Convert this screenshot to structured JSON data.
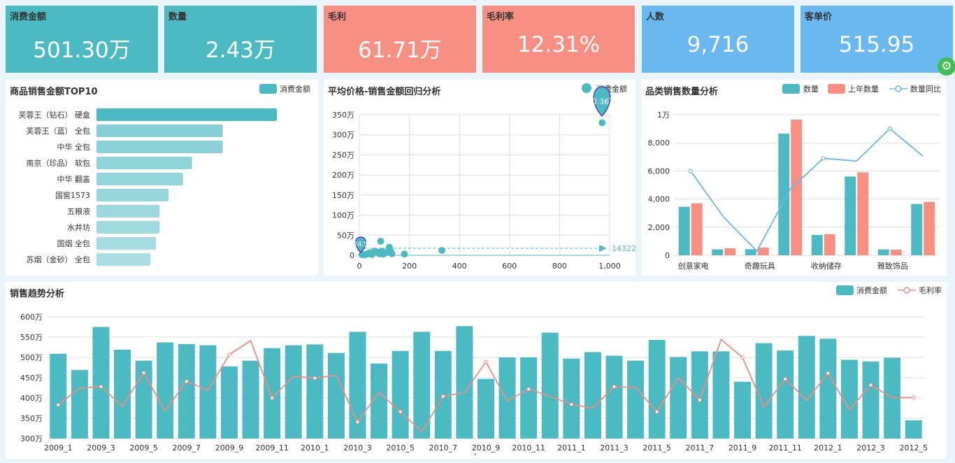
{
  "colors": {
    "teal": "#4bbac3",
    "salmon": "#f78f82",
    "blue": "#6ab8f0",
    "line_blue": "#6ab8e8",
    "line_salmon": "#f08c80"
  },
  "kpis": [
    {
      "label": "消费金额",
      "value": "501.30万",
      "color": "#4bbac3"
    },
    {
      "label": "数量",
      "value": "2.43万",
      "color": "#4bbac3"
    },
    {
      "label": "毛利",
      "value": "61.71万",
      "color": "#f78f82"
    },
    {
      "label": "毛利率",
      "value": "12.31%",
      "color": "#f78f82"
    },
    {
      "label": "人数",
      "value": "9,716",
      "color": "#6ab8f0"
    },
    {
      "label": "客单价",
      "value": "515.95",
      "color": "#6ab8f0"
    }
  ],
  "toggles": {
    "top": "˅",
    "bottom": "˄",
    "side_icon": "⚙"
  },
  "panels": {
    "top10": {
      "title": "商品销售金额TOP10",
      "legend": "消费金额"
    },
    "scatter": {
      "title": "平均价格-销售金额回归分析",
      "legend": "消费金额",
      "pin_top": "30.36万",
      "pin_left": "24.5",
      "arrow_label": "14322"
    },
    "category": {
      "title": "品类销售数量分析",
      "legend": [
        "数量",
        "上年数量",
        "数量同比"
      ]
    },
    "trend": {
      "title": "销售趋势分析",
      "legend": [
        "消费金额",
        "毛利率"
      ]
    }
  },
  "chart_data": [
    {
      "type": "bar",
      "orientation": "horizontal",
      "title": "商品销售金额TOP10",
      "categories": [
        "芙蓉王（钻石） 硬盒",
        "芙蓉王（蓝） 全包",
        "中华 全包",
        "南京（珍品） 软包",
        "中华 翻盖",
        "国窖1573",
        "五粮液",
        "水井坊",
        "国烟 全包",
        "苏烟（金砂） 全包"
      ],
      "values": [
        100,
        70,
        70,
        53,
        48,
        40,
        35,
        35,
        33,
        30
      ],
      "series": [
        {
          "name": "消费金额"
        }
      ]
    },
    {
      "type": "scatter",
      "title": "平均价格-销售金额回归分析",
      "x_ticks": [
        "0",
        "200",
        "400",
        "600",
        "800",
        "1,000"
      ],
      "y_ticks": [
        "0",
        "50万",
        "100万",
        "150万",
        "200万",
        "250万",
        "300万",
        "350万"
      ],
      "xlim": [
        0,
        1000
      ],
      "ylim": [
        0,
        350
      ],
      "series": [
        {
          "name": "消费金额",
          "points": [
            [
              5,
              24.5
            ],
            [
              10,
              2
            ],
            [
              20,
              1
            ],
            [
              30,
              3
            ],
            [
              40,
              6
            ],
            [
              50,
              2
            ],
            [
              60,
              10
            ],
            [
              70,
              8
            ],
            [
              80,
              4
            ],
            [
              85,
              35
            ],
            [
              90,
              10
            ],
            [
              95,
              3
            ],
            [
              110,
              7
            ],
            [
              120,
              20
            ],
            [
              125,
              10
            ],
            [
              130,
              4
            ],
            [
              180,
              3
            ],
            [
              330,
              12
            ],
            [
              970,
              330
            ]
          ]
        }
      ]
    },
    {
      "type": "bar",
      "title": "品类销售数量分析",
      "x_labels": [
        "创意家电",
        "",
        "奇趣玩具",
        "",
        "收纳储存",
        "",
        "雅致饰品",
        ""
      ],
      "y_ticks": [
        "0",
        "2,000",
        "4,000",
        "6,000",
        "8,000",
        "1万"
      ],
      "ylim": [
        0,
        10000
      ],
      "series": [
        {
          "name": "数量",
          "type": "bar",
          "values": [
            3450,
            420,
            430,
            8650,
            1450,
            5600,
            420,
            3650
          ]
        },
        {
          "name": "上年数量",
          "type": "bar",
          "values": [
            3700,
            500,
            550,
            9650,
            1500,
            5900,
            400,
            3800
          ]
        },
        {
          "name": "数量同比",
          "type": "line",
          "values": [
            6000,
            2700,
            300,
            4700,
            6900,
            6700,
            9000,
            7050
          ]
        }
      ]
    },
    {
      "type": "bar",
      "title": "销售趋势分析",
      "x_labels": [
        "2009_1",
        "2009_3",
        "2009_5",
        "2009_7",
        "2009_9",
        "2009_11",
        "2010_1",
        "2010_3",
        "2010_5",
        "2010_7",
        "2010_9",
        "2010_11",
        "2011_1",
        "2011_3",
        "2011_5",
        "2011_7",
        "2011_9",
        "2011_11",
        "2012_1",
        "2012_3",
        "2012_5"
      ],
      "y_ticks": [
        "300万",
        "350万",
        "400万",
        "450万",
        "500万",
        "550万",
        "600万"
      ],
      "ylim": [
        300,
        600
      ],
      "series": [
        {
          "name": "消费金额",
          "type": "bar",
          "values": [
            509,
            469,
            575,
            519,
            492,
            537,
            533,
            530,
            478,
            492,
            523,
            530,
            532,
            511,
            563,
            485,
            516,
            563,
            516,
            577,
            447,
            500,
            500,
            561,
            497,
            513,
            504,
            492,
            543,
            501,
            515,
            515,
            440,
            535,
            517,
            553,
            546,
            494,
            490,
            499,
            345
          ]
        },
        {
          "name": "毛利率",
          "type": "line",
          "values": [
            383,
            424,
            428,
            380,
            462,
            368,
            441,
            419,
            507,
            541,
            400,
            453,
            449,
            456,
            341,
            414,
            366,
            317,
            404,
            413,
            489,
            393,
            422,
            404,
            384,
            375,
            428,
            426,
            366,
            450,
            395,
            544,
            500,
            378,
            447,
            394,
            461,
            371,
            432,
            401,
            401
          ]
        }
      ]
    }
  ]
}
